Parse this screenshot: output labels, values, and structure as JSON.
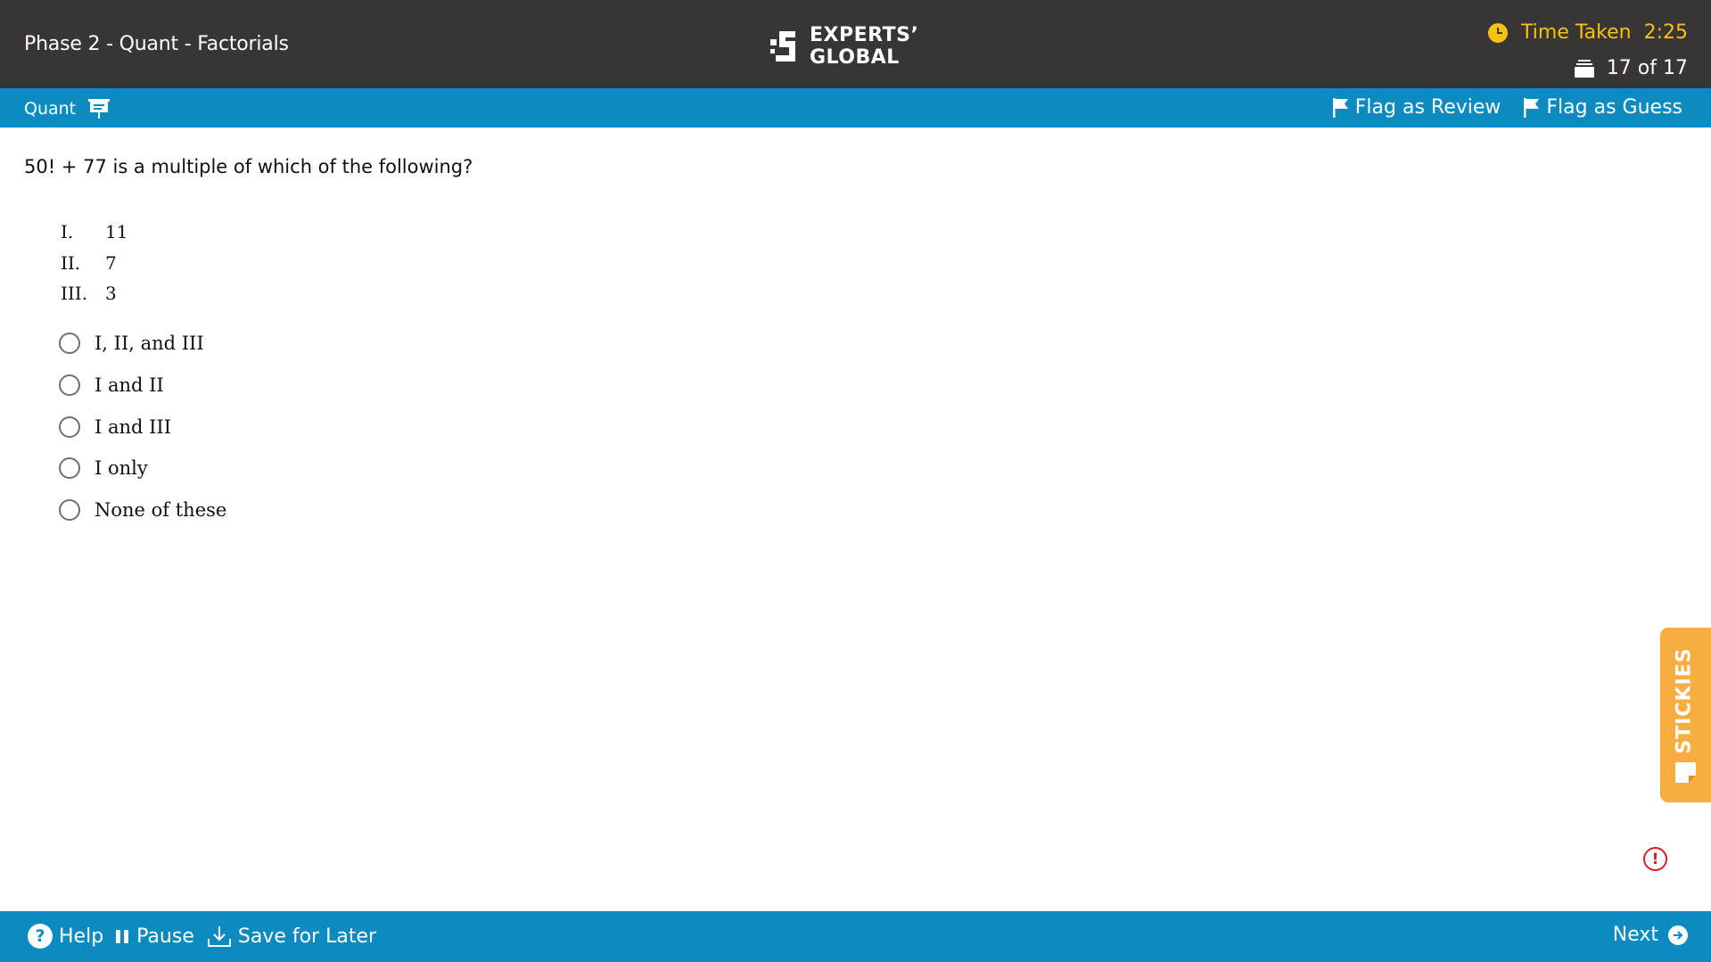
{
  "header": {
    "title": "Phase 2 - Quant - Factorials",
    "logo_line1": "EXPERTS’",
    "logo_line2": "GLOBAL",
    "timer_label": "Time Taken",
    "timer_value": "2:25",
    "progress": "17 of 17"
  },
  "toolbar": {
    "section": "Quant",
    "flag_review": "Flag as Review",
    "flag_guess": "Flag as Guess"
  },
  "question": {
    "text": "50! + 77 is a multiple of which of the following?",
    "statements": [
      {
        "num": "I.",
        "value": "11"
      },
      {
        "num": "II.",
        "value": "7"
      },
      {
        "num": "III.",
        "value": "3"
      }
    ],
    "options": [
      "I, II, and III",
      "I and II",
      "I and III",
      "I only",
      "None of these"
    ]
  },
  "stickies": {
    "label": "STICKIES"
  },
  "report": {
    "glyph": "!"
  },
  "footer": {
    "help_glyph": "?",
    "help": "Help",
    "pause": "Pause",
    "save": "Save for Later",
    "next": "Next"
  },
  "colors": {
    "header_bg": "#393534",
    "toolbar_blue": "#0b8bc0",
    "timer_yellow": "#f7c10f",
    "stickies_orange": "#f7ad3f",
    "report_red": "#d21f1f"
  }
}
